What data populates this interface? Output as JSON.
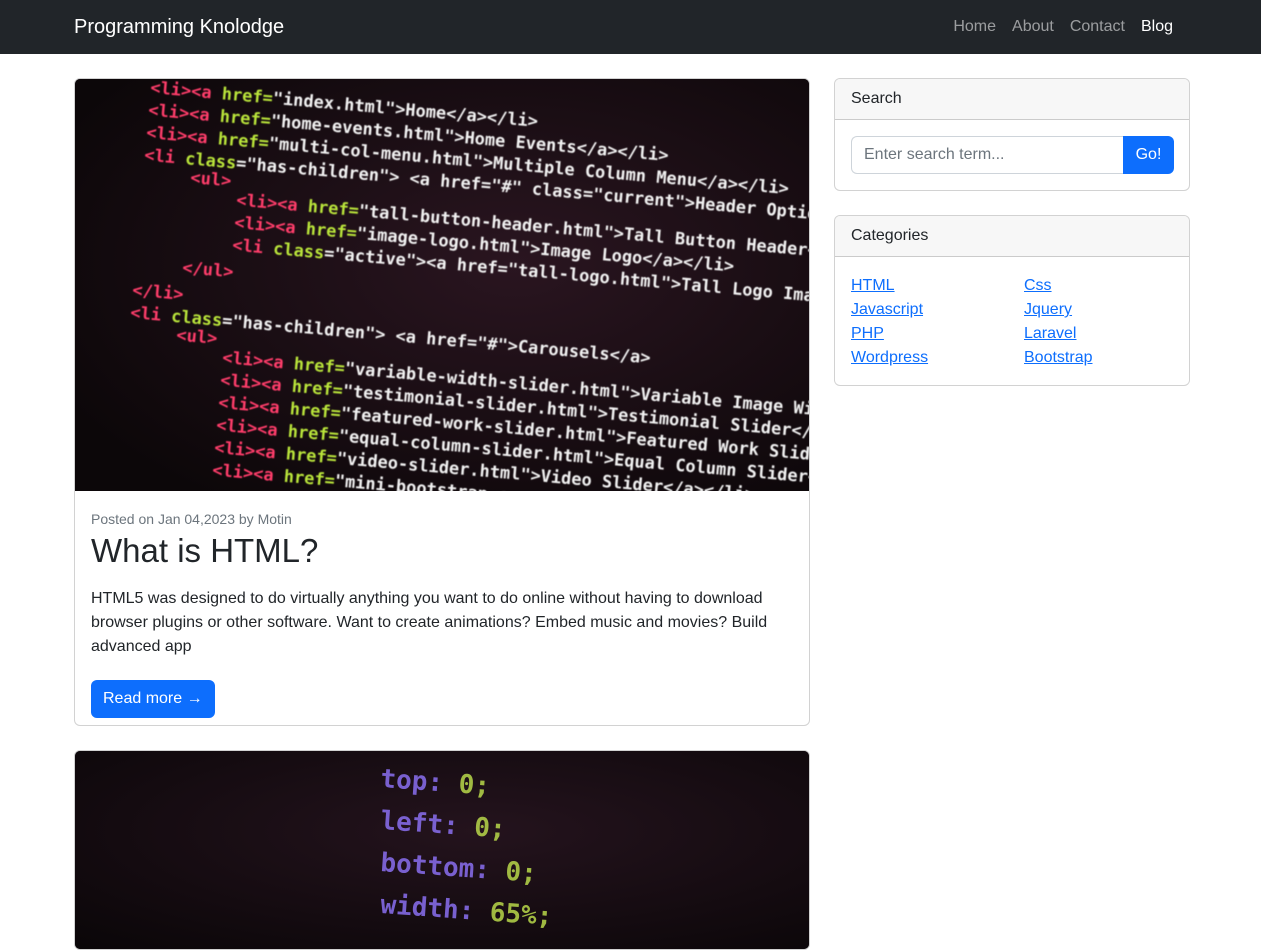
{
  "navbar": {
    "brand": "Programming Knolodge",
    "links": [
      "Home",
      "About",
      "Contact",
      "Blog"
    ],
    "active": "Blog"
  },
  "posts": [
    {
      "meta": "Posted on Jan 04,2023 by Motin",
      "title": "What is HTML?",
      "excerpt": "HTML5 was designed to do virtually anything you want to do online without having to download browser plugins or other software. Want to create animations? Embed music and movies? Build advanced app",
      "button": "Read more →",
      "code_lines": [
        "<li><a href=\"index.html\">Home</a></li>",
        "<li><a href=\"home-events.html\">Home Events</a></li>",
        "<li><a href=\"multi-col-menu.html\">Multiple Column Menu</a></li>",
        "<li class=\"has-children\"> <a href=\"#\" class=\"current\">Header Options</a>",
        "<ul>",
        "<li><a href=\"tall-button-header.html\">Tall Button Header</a></li>",
        "<li><a href=\"image-logo.html\">Image Logo</a></li>",
        "<li class=\"active\"><a href=\"tall-logo.html\">Tall Logo Image</a></li>",
        "</ul>",
        "</li>",
        "<li class=\"has-children\"> <a href=\"#\">Carousels</a>",
        "<ul>",
        "<li><a href=\"variable-width-slider.html\">Variable Image Width</a></li>",
        "<li><a href=\"testimonial-slider.html\">Testimonial Slider</a></li>",
        "<li><a href=\"featured-work-slider.html\">Featured Work Slider</a></li>",
        "<li><a href=\"equal-column-slider.html\">Equal Column Slider</a></li>",
        "<li><a href=\"video-slider.html\">Video Slider</a></li>",
        "<li><a href=\"mini-bootstrap-carousel.html\">Mini Slider</a></li>"
      ]
    },
    {
      "code_lines": [
        "top: 0;",
        "left: 0;",
        "bottom: 0;",
        "width: 65%;"
      ]
    }
  ],
  "search": {
    "header": "Search",
    "placeholder": "Enter search term...",
    "button": "Go!"
  },
  "categories": {
    "header": "Categories",
    "col1": [
      "HTML",
      "Javascript",
      "PHP",
      "Wordpress"
    ],
    "col2": [
      "Css",
      "Jquery",
      "Laravel",
      "Bootstrap"
    ]
  }
}
